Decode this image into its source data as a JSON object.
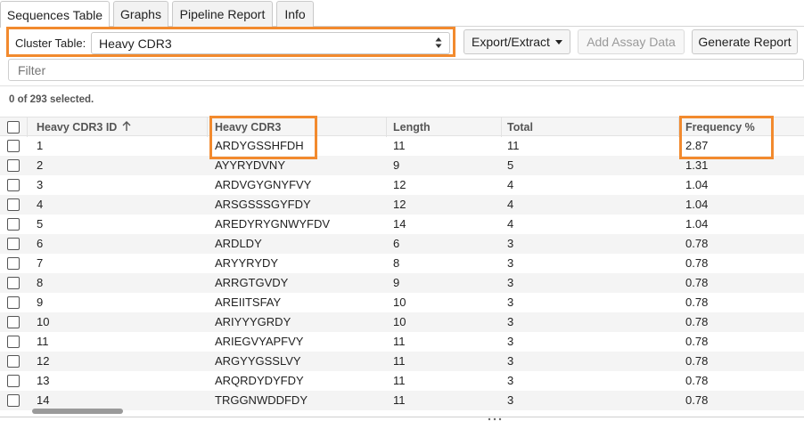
{
  "tabs": [
    {
      "label": "Sequences Table",
      "active": true
    },
    {
      "label": "Graphs",
      "active": false
    },
    {
      "label": "Pipeline Report",
      "active": false
    },
    {
      "label": "Info",
      "active": false
    }
  ],
  "toolbar": {
    "cluster_label": "Cluster Table:",
    "cluster_value": "Heavy CDR3",
    "export_label": "Export/Extract",
    "add_assay_label": "Add Assay Data",
    "generate_report_label": "Generate Report"
  },
  "filter": {
    "placeholder": "Filter"
  },
  "selection": {
    "text": "0 of 293 selected."
  },
  "table": {
    "columns": [
      "Heavy CDR3 ID",
      "Heavy CDR3",
      "Length",
      "Total",
      "Frequency %"
    ],
    "sort": {
      "column": "Heavy CDR3 ID",
      "direction": "ascending"
    },
    "rows": [
      [
        "1",
        "ARDYGSSHFDH",
        "11",
        "11",
        "2.87"
      ],
      [
        "2",
        "AYYRYDVNY",
        "9",
        "5",
        "1.31"
      ],
      [
        "3",
        "ARDVGYGNYFVY",
        "12",
        "4",
        "1.04"
      ],
      [
        "4",
        "ARSGSSSGYFDY",
        "12",
        "4",
        "1.04"
      ],
      [
        "5",
        "AREDYRYGNWYFDV",
        "14",
        "4",
        "1.04"
      ],
      [
        "6",
        "ARDLDY",
        "6",
        "3",
        "0.78"
      ],
      [
        "7",
        "ARYYRYDY",
        "8",
        "3",
        "0.78"
      ],
      [
        "8",
        "ARRGTGVDY",
        "9",
        "3",
        "0.78"
      ],
      [
        "9",
        "AREIITSFAY",
        "10",
        "3",
        "0.78"
      ],
      [
        "10",
        "ARIYYYGRDY",
        "10",
        "3",
        "0.78"
      ],
      [
        "11",
        "ARIEGVYAPFVY",
        "11",
        "3",
        "0.78"
      ],
      [
        "12",
        "ARGYYGSSLVY",
        "11",
        "3",
        "0.78"
      ],
      [
        "13",
        "ARQRDYDYFDY",
        "11",
        "3",
        "0.78"
      ],
      [
        "14",
        "TRGGNWDDFDY",
        "11",
        "3",
        "0.78"
      ]
    ]
  },
  "colors": {
    "highlight": "#f28a2e"
  },
  "icons": {
    "sort": "arrow-up-icon",
    "select": "up-down-arrows-icon",
    "dropdown": "caret-down-icon"
  }
}
